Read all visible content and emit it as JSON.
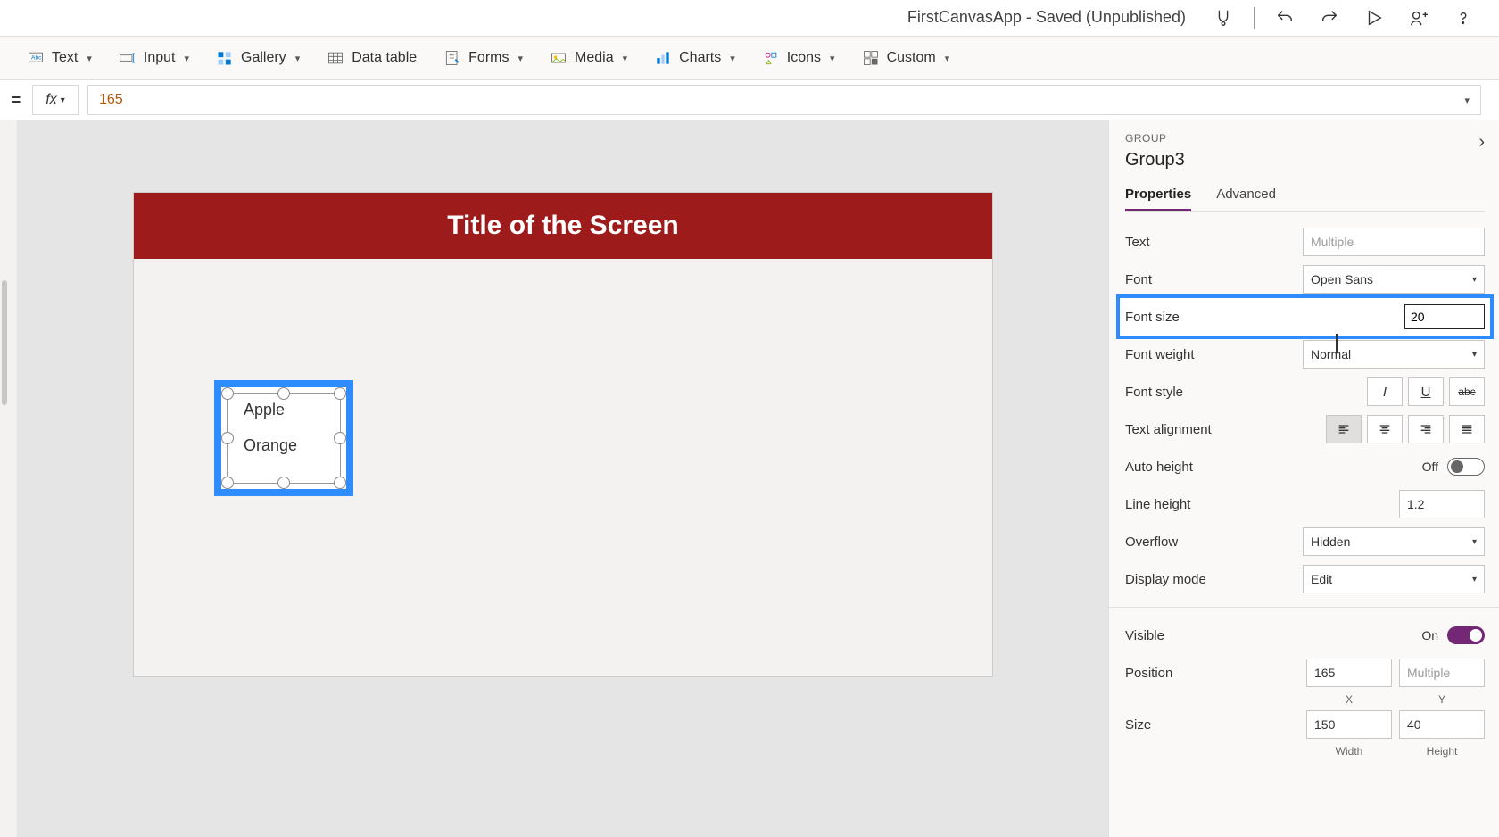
{
  "header": {
    "app_title": "FirstCanvasApp - Saved (Unpublished)"
  },
  "ribbon": {
    "text": "Text",
    "input": "Input",
    "gallery": "Gallery",
    "data_table": "Data table",
    "forms": "Forms",
    "media": "Media",
    "charts": "Charts",
    "icons": "Icons",
    "custom": "Custom"
  },
  "formula": {
    "fx_label": "fx",
    "value": "165"
  },
  "canvas": {
    "screen_title": "Title of the Screen",
    "selected_labels": [
      "Apple",
      "Orange"
    ]
  },
  "panel": {
    "type_label": "GROUP",
    "object_name": "Group3",
    "tabs": {
      "properties": "Properties",
      "advanced": "Advanced"
    },
    "props": {
      "text_label": "Text",
      "text_value_placeholder": "Multiple",
      "font_label": "Font",
      "font_value": "Open Sans",
      "font_size_label": "Font size",
      "font_size_value": "20",
      "font_weight_label": "Font weight",
      "font_weight_value": "Normal",
      "font_style_label": "Font style",
      "text_align_label": "Text alignment",
      "auto_height_label": "Auto height",
      "auto_height_value": "Off",
      "line_height_label": "Line height",
      "line_height_value": "1.2",
      "overflow_label": "Overflow",
      "overflow_value": "Hidden",
      "display_mode_label": "Display mode",
      "display_mode_value": "Edit",
      "visible_label": "Visible",
      "visible_value": "On",
      "position_label": "Position",
      "position_x": "165",
      "position_y_placeholder": "Multiple",
      "position_x_caption": "X",
      "position_y_caption": "Y",
      "size_label": "Size",
      "size_w": "150",
      "size_h": "40",
      "size_w_caption": "Width",
      "size_h_caption": "Height"
    }
  }
}
